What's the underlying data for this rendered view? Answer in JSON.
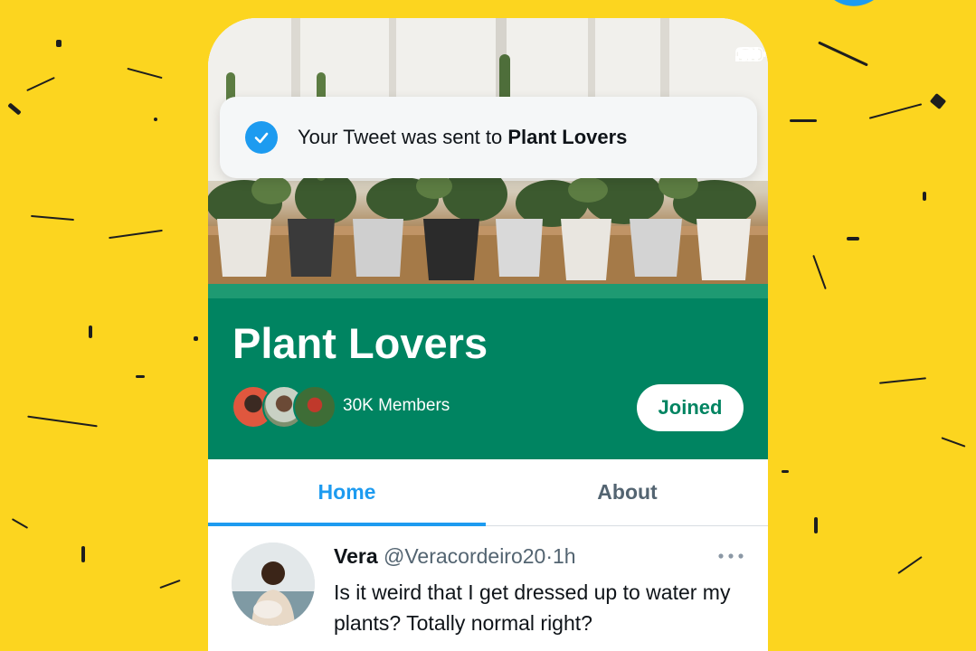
{
  "toast": {
    "prefix": "Your Tweet was sent to ",
    "community": "Plant Lovers"
  },
  "community": {
    "title": "Plant Lovers",
    "members": "30K Members",
    "joined_label": "Joined"
  },
  "tabs": [
    {
      "label": "Home",
      "active": true
    },
    {
      "label": "About",
      "active": false
    }
  ],
  "tweet": {
    "name": "Vera",
    "handle": "@Veracordeiro20",
    "separator": "·",
    "time": "1h",
    "text": "Is it weird that I get dressed up to water my plants? Totally normal right?"
  },
  "icons": {
    "brand": "twitter-bird-icon",
    "toast": "check-circle-icon",
    "tweet_menu": "more-horizontal-icon"
  },
  "colors": {
    "background": "#fcd51f",
    "community_green": "#008461",
    "twitter_blue": "#1d9bf0"
  }
}
